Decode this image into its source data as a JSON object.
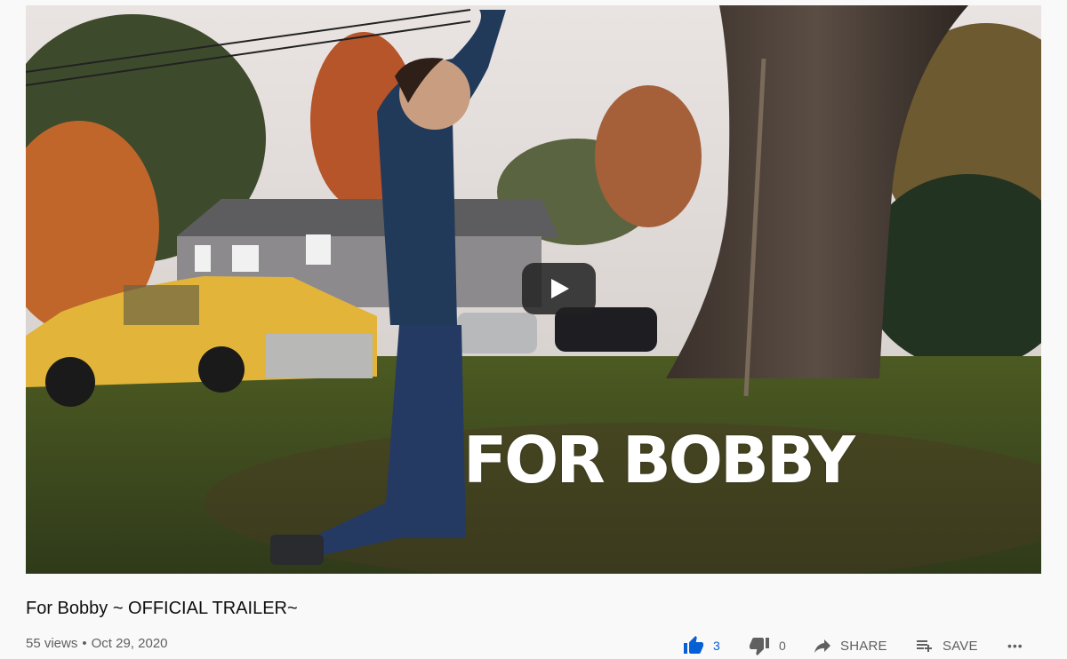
{
  "video": {
    "overlay_text": "FOR BOBBY",
    "title": "For Bobby ~ OFFICIAL TRAILER~",
    "views": "55 views",
    "separator": "•",
    "date": "Oct 29, 2020"
  },
  "actions": {
    "like_count": "3",
    "dislike_count": "0",
    "share_label": "SHARE",
    "save_label": "SAVE",
    "more_label": "•••"
  },
  "icons": {
    "like": "thumbs-up-icon",
    "dislike": "thumbs-down-icon",
    "share": "share-arrow-icon",
    "save": "playlist-add-icon",
    "more": "more-horizontal-icon",
    "play": "play-icon"
  },
  "colors": {
    "liked": "#065fd4",
    "text_secondary": "#606060",
    "text_primary": "#0f0f0f",
    "background": "#f9f9f9"
  }
}
